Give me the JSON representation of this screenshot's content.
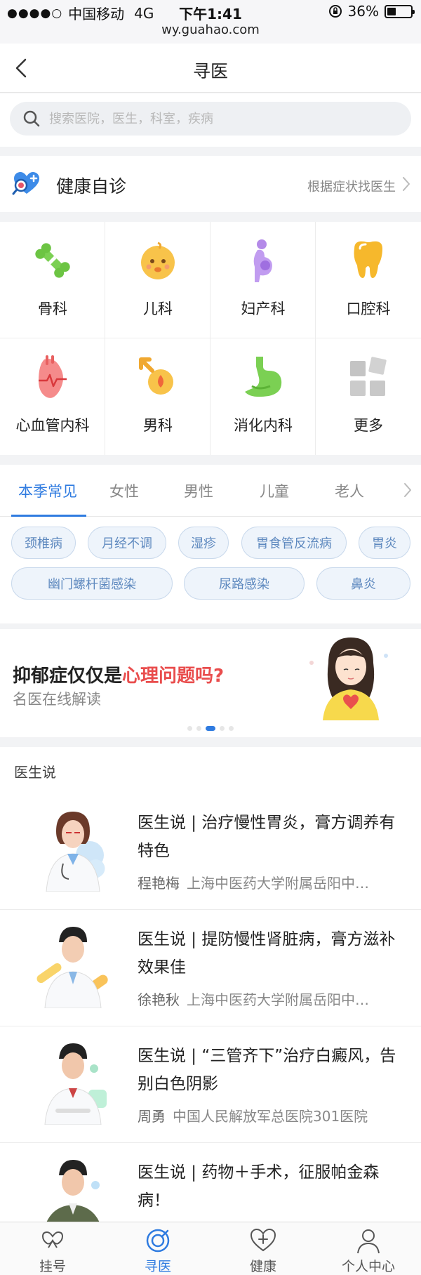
{
  "status_bar": {
    "signal_dots": "●●●●○",
    "carrier": "中国移动",
    "network": "4G",
    "time": "下午1:41",
    "battery_percent": "36%",
    "battery_level": 0.36,
    "url": "wy.guahao.com"
  },
  "nav": {
    "title": "寻医",
    "back_icon": "chevron-left-icon"
  },
  "search": {
    "placeholder": "搜索医院，医生，科室，疾病",
    "icon": "search-icon"
  },
  "self_diagnose": {
    "title": "健康自诊",
    "subtitle": "根据症状找医生",
    "icon": "heart-magnifier-icon"
  },
  "departments": [
    {
      "label": "骨科",
      "icon": "bone-icon"
    },
    {
      "label": "儿科",
      "icon": "baby-icon"
    },
    {
      "label": "妇产科",
      "icon": "pregnant-icon"
    },
    {
      "label": "口腔科",
      "icon": "tooth-icon"
    },
    {
      "label": "心血管内科",
      "icon": "heart-organ-icon"
    },
    {
      "label": "男科",
      "icon": "male-icon"
    },
    {
      "label": "消化内科",
      "icon": "stomach-icon"
    },
    {
      "label": "更多",
      "icon": "more-grid-icon"
    }
  ],
  "tabs": {
    "items": [
      "本季常见",
      "女性",
      "男性",
      "儿童",
      "老人"
    ],
    "active_index": 0
  },
  "chips": {
    "row1": [
      "颈椎病",
      "月经不调",
      "湿疹",
      "胃食管反流病",
      "胃炎"
    ],
    "row2": [
      "幽门螺杆菌感染",
      "尿路感染",
      "鼻炎"
    ]
  },
  "banner": {
    "title_black": "抑郁症仅仅是",
    "title_red": "心理问题吗?",
    "subtitle": "名医在线解读",
    "image": "woman-illustration",
    "dot_count": 5,
    "active_dot": 2
  },
  "articles_section": {
    "title": "医生说",
    "items": [
      {
        "title": "医生说 | 治疗慢性胃炎，膏方调养有特色",
        "author": "程艳梅",
        "hospital": "上海中医药大学附属岳阳中…"
      },
      {
        "title": "医生说 | 提防慢性肾脏病，膏方滋补效果佳",
        "author": "徐艳秋",
        "hospital": "上海中医药大学附属岳阳中…"
      },
      {
        "title": "医生说 | “三管齐下”治疗白癜风，告别白色阴影",
        "author": "周勇",
        "hospital": "中国人民解放军总医院301医院"
      },
      {
        "title": "医生说 | 药物＋手术，征服帕金森病！",
        "author": "",
        "hospital": ""
      }
    ]
  },
  "tabbar": {
    "items": [
      {
        "label": "挂号",
        "icon": "register-icon"
      },
      {
        "label": "寻医",
        "icon": "find-doctor-icon"
      },
      {
        "label": "健康",
        "icon": "health-heart-icon"
      },
      {
        "label": "个人中心",
        "icon": "person-icon"
      }
    ],
    "active_index": 1
  },
  "colors": {
    "accent": "#2f7be0",
    "highlight_red": "#e94d4d",
    "chip_text": "#5e89bf"
  }
}
